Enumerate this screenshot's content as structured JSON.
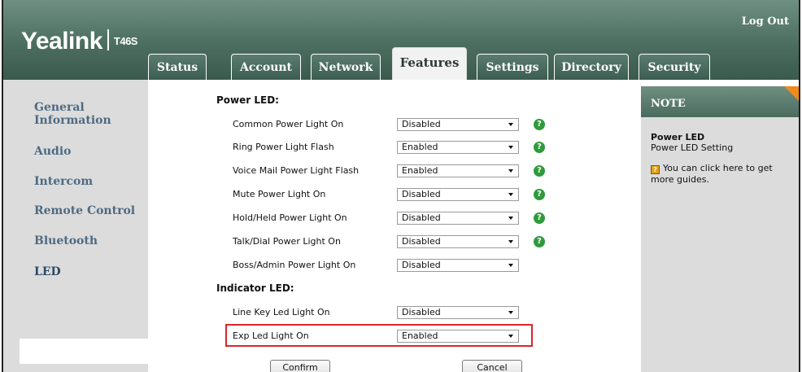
{
  "header": {
    "brand": "Yealink",
    "model": "T46S",
    "logout": "Log Out"
  },
  "tabs": [
    {
      "label": "Status",
      "active": false
    },
    {
      "label": "Account",
      "active": false
    },
    {
      "label": "Network",
      "active": false
    },
    {
      "label": "Features",
      "active": true
    },
    {
      "label": "Settings",
      "active": false
    },
    {
      "label": "Directory",
      "active": false
    },
    {
      "label": "Security",
      "active": false
    }
  ],
  "sidebar": {
    "items": [
      {
        "label": "General Information",
        "active": false
      },
      {
        "label": "Audio",
        "active": false
      },
      {
        "label": "Intercom",
        "active": false
      },
      {
        "label": "Remote Control",
        "active": false
      },
      {
        "label": "Bluetooth",
        "active": false
      },
      {
        "label": "LED",
        "active": true
      }
    ]
  },
  "power_led": {
    "heading": "Power LED:",
    "rows": [
      {
        "label": "Common Power Light On",
        "value": "Disabled",
        "help": "?"
      },
      {
        "label": "Ring Power Light Flash",
        "value": "Enabled",
        "help": "?"
      },
      {
        "label": "Voice Mail Power Light Flash",
        "value": "Enabled",
        "help": "?"
      },
      {
        "label": "Mute Power Light On",
        "value": "Disabled",
        "help": "?"
      },
      {
        "label": "Hold/Held Power Light On",
        "value": "Disabled",
        "help": "?"
      },
      {
        "label": "Talk/Dial Power Light On",
        "value": "Disabled",
        "help": "?"
      },
      {
        "label": "Boss/Admin Power Light On",
        "value": "Disabled"
      }
    ]
  },
  "indicator_led": {
    "heading": "Indicator LED:",
    "rows": [
      {
        "label": "Line Key Led Light On",
        "value": "Disabled"
      },
      {
        "label": "Exp Led Light On",
        "value": "Enabled",
        "highlighted": true
      }
    ]
  },
  "buttons": {
    "confirm": "Confirm",
    "cancel": "Cancel"
  },
  "note": {
    "title": "NOTE",
    "heading": "Power LED",
    "subheading": "Power LED Setting",
    "guide_text": "You can click here to get more guides.",
    "accent_color": "#f08a1c"
  },
  "colors": {
    "header": "#4c6e61",
    "highlight_border": "#d8262c",
    "help_icon": "#2f9a3c"
  }
}
